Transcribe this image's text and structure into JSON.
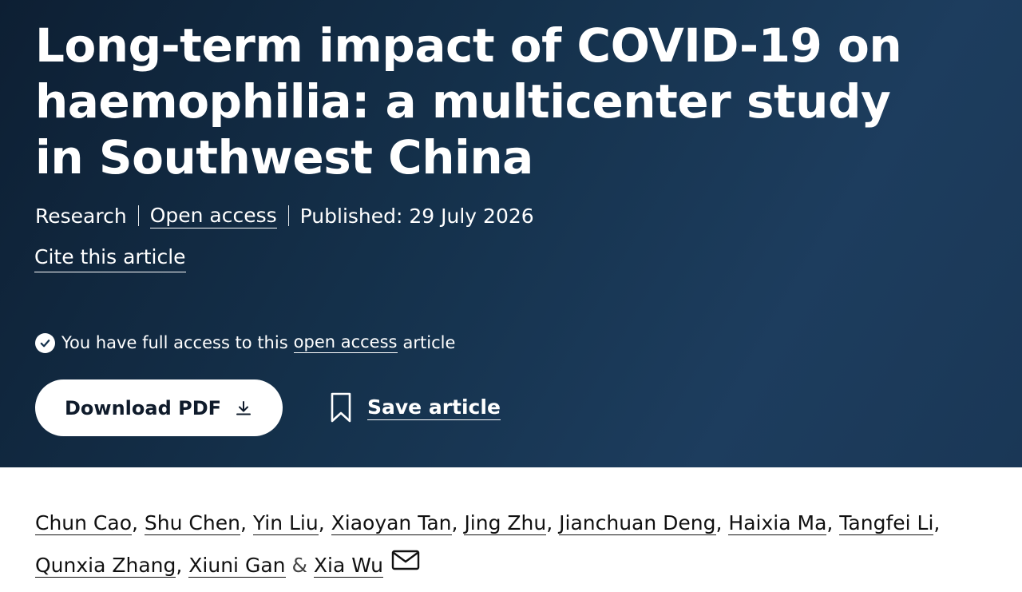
{
  "article": {
    "title": "Long-term impact of COVID-19 on haemophilia: a multicenter study in Southwest China",
    "type": "Research",
    "access_label": "Open access",
    "published": "Published: 29 July 2026",
    "cite_label": "Cite this article",
    "access_notice": {
      "prefix": "You have full access to this",
      "link": "open access",
      "suffix": "article"
    },
    "download_label": "Download PDF",
    "save_label": "Save article"
  },
  "authors": {
    "list": [
      "Chun Cao",
      "Shu Chen",
      "Yin Liu",
      "Xiaoyan Tan",
      "Jing Zhu",
      "Jianchuan Deng",
      "Haixia Ma",
      "Tangfei Li",
      "Qunxia Zhang",
      "Xiuni Gan",
      "Xia Wu"
    ],
    "separator": ",",
    "last_separator": "&"
  },
  "icons": {
    "check": "check-circle-icon",
    "download": "download-icon",
    "bookmark": "bookmark-icon",
    "mail": "mail-icon"
  },
  "colors": {
    "hero_background": "#15324d",
    "text_on_dark": "#ffffff",
    "button_text": "#0f1b2b"
  }
}
